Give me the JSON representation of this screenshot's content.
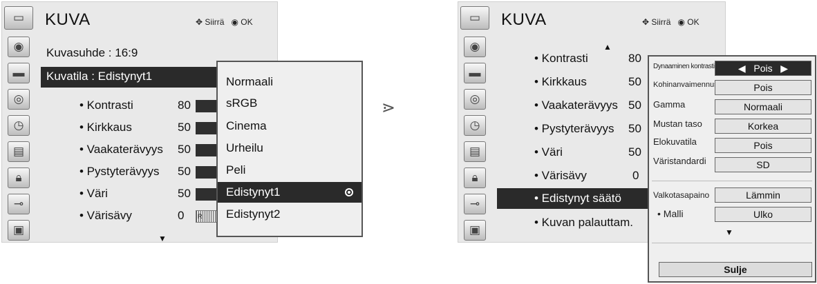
{
  "left_panel": {
    "title": "KUVA",
    "nav_move": "Siirrä",
    "nav_ok": "OK",
    "rows": {
      "aspect": "Kuvasuhde : 16:9",
      "mode": "Kuvatila    : Edistynyt1",
      "contrast_label": "• Kontrasti",
      "contrast_value": "80",
      "brightness_label": "• Kirkkaus",
      "brightness_value": "50",
      "h_sharp_label": "• Vaakaterävyys",
      "h_sharp_value": "50",
      "v_sharp_label": "• Pystyterävyys",
      "v_sharp_value": "50",
      "color_label": "• Väri",
      "color_value": "50",
      "tint_label": "• Värisävy",
      "tint_value": "0",
      "tint_bar_text": "R"
    },
    "dropdown": [
      "Normaali",
      "sRGB",
      "Cinema",
      "Urheilu",
      "Peli",
      "Edistynyt1",
      "Edistynyt2"
    ],
    "dropdown_selected": "Edistynyt1"
  },
  "arrow_symbol": "⋗",
  "right_panel": {
    "title": "KUVA",
    "nav_move": "Siirrä",
    "nav_ok": "OK",
    "rows": {
      "contrast_label": "• Kontrasti",
      "contrast_value": "80",
      "brightness_label": "• Kirkkaus",
      "brightness_value": "50",
      "h_sharp_label": "• Vaakaterävyys",
      "h_sharp_value": "50",
      "v_sharp_label": "• Pystyterävyys",
      "v_sharp_value": "50",
      "color_label": "• Väri",
      "color_value": "50",
      "tint_label": "• Värisävy",
      "tint_value": "0",
      "advanced_label": "• Edistynyt säätö",
      "reset_label": "• Kuvan palauttam."
    },
    "submenu": {
      "dyn_contrast_label": "Dynaaminen kontrasti",
      "dyn_contrast_value": "Pois",
      "noise_label": "Kohinanvaimennus",
      "noise_value": "Pois",
      "gamma_label": "Gamma",
      "gamma_value": "Normaali",
      "black_label": "Mustan taso",
      "black_value": "Korkea",
      "film_label": "Elokuvatila",
      "film_value": "Pois",
      "color_std_label": "Väristandardi",
      "color_std_value": "SD",
      "wb_label": "Valkotasapaino",
      "wb_value": "Lämmin",
      "pattern_label": "• Malli",
      "pattern_value": "Ulko",
      "close_label": "Sulje"
    }
  }
}
